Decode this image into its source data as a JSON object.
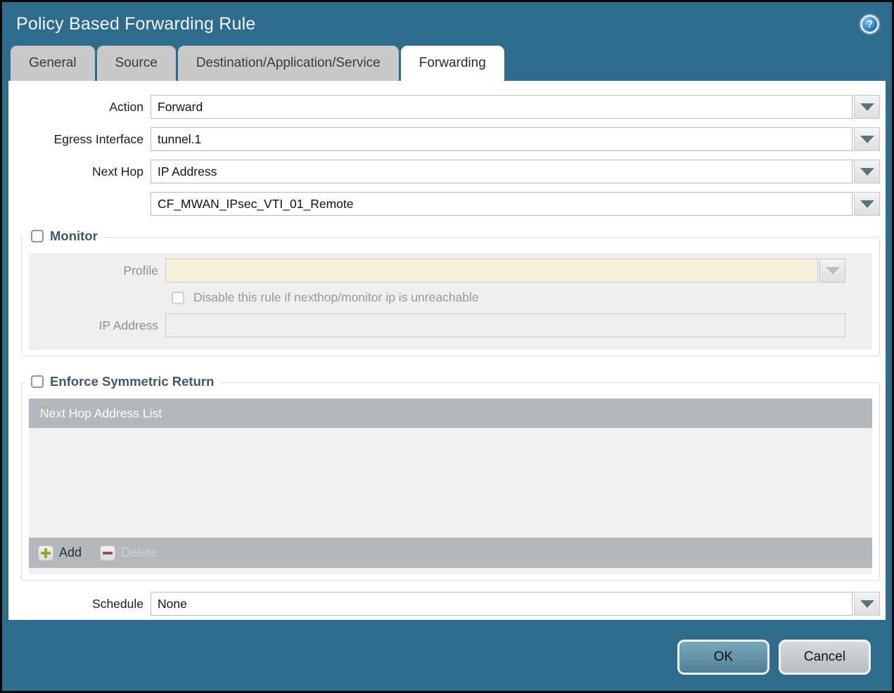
{
  "dialog": {
    "title": "Policy Based Forwarding Rule",
    "help_glyph": "?"
  },
  "tabs": [
    {
      "label": "General",
      "active": false
    },
    {
      "label": "Source",
      "active": false
    },
    {
      "label": "Destination/Application/Service",
      "active": false
    },
    {
      "label": "Forwarding",
      "active": true
    }
  ],
  "form": {
    "action": {
      "label": "Action",
      "value": "Forward"
    },
    "egress_interface": {
      "label": "Egress Interface",
      "value": "tunnel.1"
    },
    "next_hop": {
      "label": "Next Hop",
      "value": "IP Address"
    },
    "next_hop_address": {
      "value": "CF_MWAN_IPsec_VTI_01_Remote"
    },
    "schedule": {
      "label": "Schedule",
      "value": "None"
    }
  },
  "monitor": {
    "title": "Monitor",
    "checked": false,
    "profile": {
      "label": "Profile",
      "value": ""
    },
    "disable_rule": {
      "label": "Disable this rule if nexthop/monitor ip is unreachable",
      "checked": false
    },
    "ip_address": {
      "label": "IP Address",
      "value": ""
    }
  },
  "enforce_symmetric_return": {
    "title": "Enforce Symmetric Return",
    "checked": false,
    "table": {
      "header": "Next Hop Address List",
      "rows": [],
      "add_label": "Add",
      "delete_label": "Delete",
      "delete_enabled": false
    }
  },
  "footer": {
    "ok_label": "OK",
    "cancel_label": "Cancel"
  },
  "colors": {
    "titlebar_teal": "#2f6b8a",
    "active_tab": "#ffffff",
    "inactive_tab": "#c9c9c9",
    "disabled_field_beige": "#f6efdc",
    "table_bar_gray": "#b2b8bc",
    "ok_button": "#5e93ab",
    "legend_text": "#44576a",
    "add_plus_green": "#97a733",
    "delete_minus_red": "#9c4e57"
  }
}
